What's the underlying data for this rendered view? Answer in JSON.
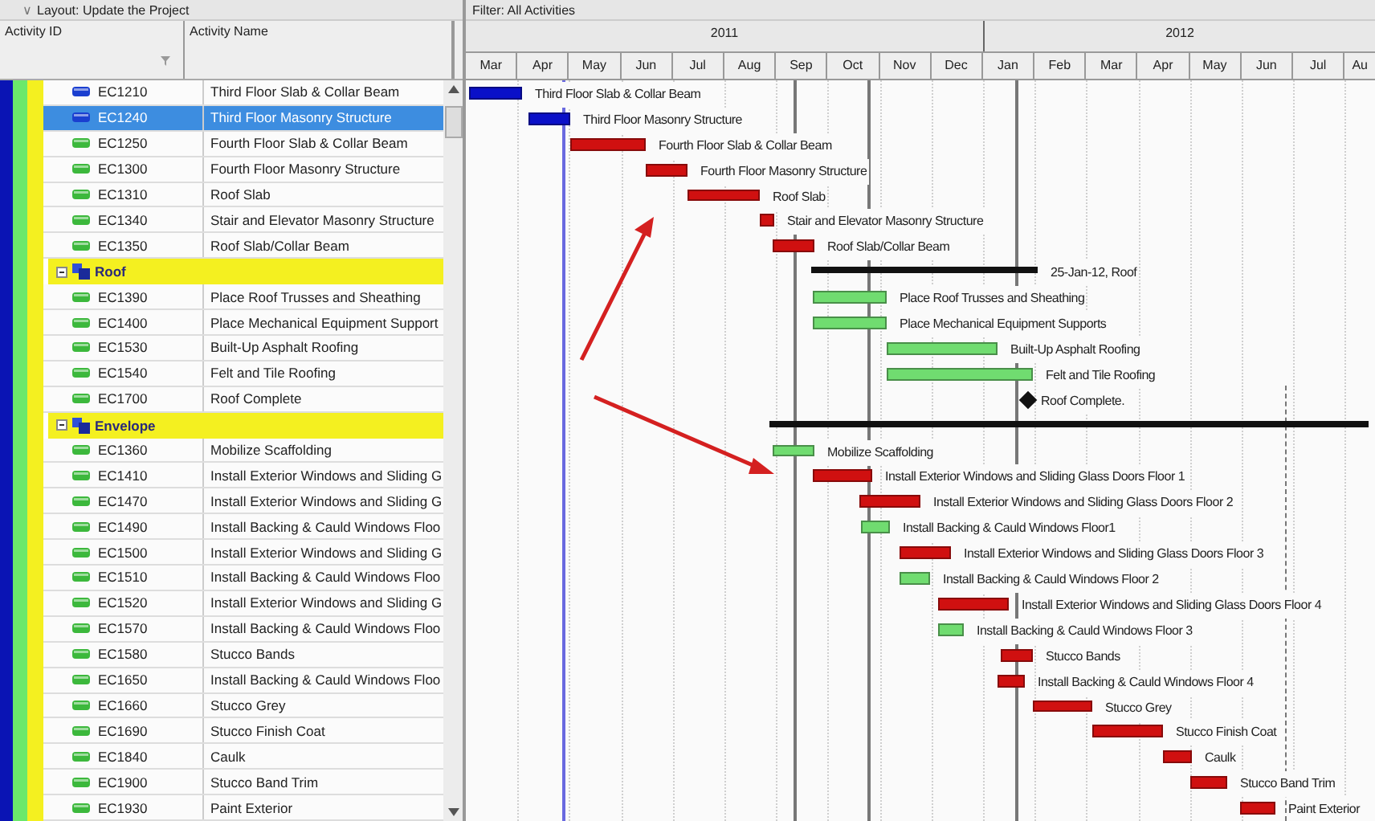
{
  "layout_bar": {
    "chevron": "∨",
    "title": "Layout: Update the Project"
  },
  "filter_bar": {
    "title": "Filter: All Activities"
  },
  "columns": [
    {
      "label": "Activity ID"
    },
    {
      "label": "Activity Name"
    }
  ],
  "years": [
    {
      "label": "2011"
    },
    {
      "label": "2012"
    }
  ],
  "months": [
    "Mar",
    "Apr",
    "May",
    "Jun",
    "Jul",
    "Aug",
    "Sep",
    "Oct",
    "Nov",
    "Dec",
    "Jan",
    "Feb",
    "Mar",
    "Apr",
    "May",
    "Jun",
    "Jul",
    "Au"
  ],
  "rows": [
    {
      "kind": "activity",
      "id": "EC1210",
      "name": "Third Floor Slab & Collar Beam",
      "icon": {
        "color": "#1a3fd0"
      },
      "selected": false,
      "bar": {
        "color": "#0a10c8",
        "label": "Third Floor Slab & Collar Beam"
      }
    },
    {
      "kind": "activity",
      "id": "EC1240",
      "name": "Third Floor Masonry Structure",
      "icon": {
        "color": "#1a3fd0"
      },
      "selected": true,
      "bar": {
        "color": "#0a10c8",
        "label": "Third Floor Masonry Structure"
      }
    },
    {
      "kind": "activity",
      "id": "EC1250",
      "name": "Fourth Floor Slab & Collar Beam",
      "icon": {
        "color": "#3cb83c"
      },
      "selected": false,
      "bar": {
        "color": "#d01010",
        "label": "Fourth Floor Slab & Collar Beam"
      }
    },
    {
      "kind": "activity",
      "id": "EC1300",
      "name": "Fourth Floor Masonry Structure",
      "icon": {
        "color": "#3cb83c"
      },
      "selected": false,
      "bar": {
        "color": "#d01010",
        "label": "Fourth Floor Masonry Structure"
      }
    },
    {
      "kind": "activity",
      "id": "EC1310",
      "name": "Roof Slab",
      "icon": {
        "color": "#3cb83c"
      },
      "selected": false,
      "bar": {
        "color": "#d01010",
        "label": "Roof Slab"
      }
    },
    {
      "kind": "activity",
      "id": "EC1340",
      "name": "Stair and Elevator Masonry Structure",
      "icon": {
        "color": "#3cb83c"
      },
      "selected": false,
      "bar": {
        "color": "#d01010",
        "label": "Stair and Elevator Masonry Structure"
      }
    },
    {
      "kind": "activity",
      "id": "EC1350",
      "name": "Roof Slab/Collar Beam",
      "icon": {
        "color": "#3cb83c"
      },
      "selected": false,
      "bar": {
        "color": "#d01010",
        "label": "Roof Slab/Collar Beam"
      }
    },
    {
      "kind": "group",
      "name": "Roof",
      "expanded": true,
      "summary": {
        "label": "25-Jan-12, Roof"
      }
    },
    {
      "kind": "activity",
      "id": "EC1390",
      "name": "Place Roof Trusses and Sheathing",
      "icon": {
        "color": "#3cb83c"
      },
      "selected": false,
      "bar": {
        "color": "#70dc70",
        "label": "Place Roof Trusses and Sheathing"
      }
    },
    {
      "kind": "activity",
      "id": "EC1400",
      "name": "Place Mechanical Equipment Support",
      "icon": {
        "color": "#3cb83c"
      },
      "selected": false,
      "bar": {
        "color": "#70dc70",
        "label": "Place Mechanical Equipment Supports"
      }
    },
    {
      "kind": "activity",
      "id": "EC1530",
      "name": "Built-Up Asphalt Roofing",
      "icon": {
        "color": "#3cb83c"
      },
      "selected": false,
      "bar": {
        "color": "#70dc70",
        "label": "Built-Up Asphalt Roofing"
      }
    },
    {
      "kind": "activity",
      "id": "EC1540",
      "name": "Felt and Tile Roofing",
      "icon": {
        "color": "#3cb83c"
      },
      "selected": false,
      "bar": {
        "color": "#70dc70",
        "label": "Felt and Tile Roofing"
      }
    },
    {
      "kind": "milestone",
      "id": "EC1700",
      "name": "Roof Complete",
      "icon": {
        "color": "#3cb83c"
      },
      "selected": false,
      "bar": {
        "color": "#111111",
        "label": "Roof Complete."
      }
    },
    {
      "kind": "group",
      "name": "Envelope",
      "expanded": true,
      "summary": {}
    },
    {
      "kind": "activity",
      "id": "EC1360",
      "name": "Mobilize Scaffolding",
      "icon": {
        "color": "#3cb83c"
      },
      "selected": false,
      "bar": {
        "color": "#70dc70",
        "label": "Mobilize Scaffolding"
      }
    },
    {
      "kind": "activity",
      "id": "EC1410",
      "name": "Install Exterior Windows and Sliding G",
      "icon": {
        "color": "#3cb83c"
      },
      "selected": false,
      "bar": {
        "color": "#d01010",
        "label": "Install Exterior Windows and Sliding Glass Doors Floor 1"
      }
    },
    {
      "kind": "activity",
      "id": "EC1470",
      "name": "Install Exterior Windows and Sliding G",
      "icon": {
        "color": "#3cb83c"
      },
      "selected": false,
      "bar": {
        "color": "#d01010",
        "label": "Install Exterior Windows and Sliding Glass Doors Floor 2"
      }
    },
    {
      "kind": "activity",
      "id": "EC1490",
      "name": "Install Backing & Cauld Windows Floo",
      "icon": {
        "color": "#3cb83c"
      },
      "selected": false,
      "bar": {
        "color": "#70dc70",
        "label": "Install Backing & Cauld Windows Floor1"
      }
    },
    {
      "kind": "activity",
      "id": "EC1500",
      "name": "Install Exterior Windows and Sliding G",
      "icon": {
        "color": "#3cb83c"
      },
      "selected": false,
      "bar": {
        "color": "#d01010",
        "label": "Install Exterior Windows and Sliding Glass Doors Floor 3"
      }
    },
    {
      "kind": "activity",
      "id": "EC1510",
      "name": "Install Backing & Cauld Windows Floo",
      "icon": {
        "color": "#3cb83c"
      },
      "selected": false,
      "bar": {
        "color": "#70dc70",
        "label": "Install Backing & Cauld Windows Floor 2"
      }
    },
    {
      "kind": "activity",
      "id": "EC1520",
      "name": "Install Exterior Windows and Sliding G",
      "icon": {
        "color": "#3cb83c"
      },
      "selected": false,
      "bar": {
        "color": "#d01010",
        "label": "Install Exterior Windows and Sliding Glass Doors Floor 4"
      }
    },
    {
      "kind": "activity",
      "id": "EC1570",
      "name": "Install Backing & Cauld Windows Floo",
      "icon": {
        "color": "#3cb83c"
      },
      "selected": false,
      "bar": {
        "color": "#70dc70",
        "label": "Install Backing & Cauld Windows Floor 3"
      }
    },
    {
      "kind": "activity",
      "id": "EC1580",
      "name": "Stucco Bands",
      "icon": {
        "color": "#3cb83c"
      },
      "selected": false,
      "bar": {
        "color": "#d01010",
        "label": "Stucco Bands"
      }
    },
    {
      "kind": "activity",
      "id": "EC1650",
      "name": "Install Backing & Cauld Windows Floo",
      "icon": {
        "color": "#3cb83c"
      },
      "selected": false,
      "bar": {
        "color": "#d01010",
        "label": "Install Backing & Cauld Windows Floor 4"
      }
    },
    {
      "kind": "activity",
      "id": "EC1660",
      "name": "Stucco Grey",
      "icon": {
        "color": "#3cb83c"
      },
      "selected": false,
      "bar": {
        "color": "#d01010",
        "label": "Stucco Grey"
      }
    },
    {
      "kind": "activity",
      "id": "EC1690",
      "name": "Stucco Finish Coat",
      "icon": {
        "color": "#3cb83c"
      },
      "selected": false,
      "bar": {
        "color": "#d01010",
        "label": "Stucco Finish Coat"
      }
    },
    {
      "kind": "activity",
      "id": "EC1840",
      "name": "Caulk",
      "icon": {
        "color": "#3cb83c"
      },
      "selected": false,
      "bar": {
        "color": "#d01010",
        "label": "Caulk"
      }
    },
    {
      "kind": "activity",
      "id": "EC1900",
      "name": "Stucco Band Trim",
      "icon": {
        "color": "#3cb83c"
      },
      "selected": false,
      "bar": {
        "color": "#d01010",
        "label": "Stucco Band Trim"
      }
    },
    {
      "kind": "activity",
      "id": "EC1930",
      "name": "Paint Exterior",
      "icon": {
        "color": "#3cb83c"
      },
      "selected": false,
      "bar": {
        "color": "#d01010",
        "label": "Paint Exterior"
      }
    }
  ]
}
